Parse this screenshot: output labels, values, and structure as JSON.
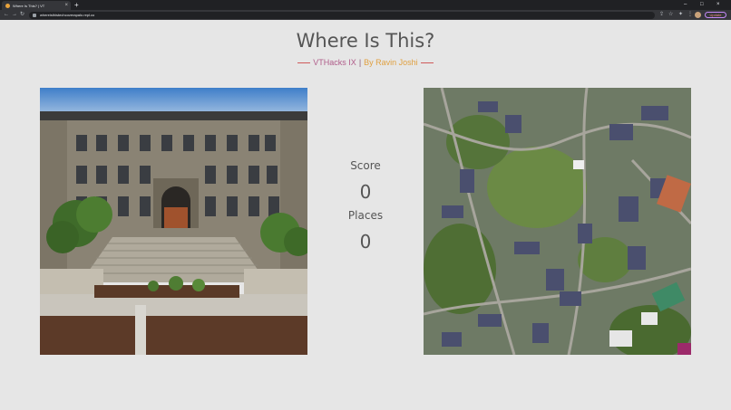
{
  "browser": {
    "tab_title": "Where Is This? | VT",
    "url": "whereisthistechcoverapalo.repl.co",
    "update_label": "Update",
    "new_tab_label": "+",
    "close_label": "×",
    "minimize_label": "–",
    "maximize_label": "□",
    "window_close_label": "×",
    "back_label": "←",
    "forward_label": "→",
    "reload_label": "↻",
    "share_label": "⇪",
    "star_label": "☆",
    "extensions_label": "✦",
    "menu_label": "⋮"
  },
  "page": {
    "title": "Where Is This?",
    "event": "VTHacks IX",
    "separator": "|",
    "author": "By Ravin Joshi"
  },
  "stats": {
    "score_label": "Score",
    "score_value": "0",
    "places_label": "Places",
    "places_value": "0"
  },
  "colors": {
    "background": "#e6e6e6",
    "subtitle_event": "#b05d8a",
    "subtitle_author": "#e0a040",
    "dash": "#d05a5a"
  }
}
